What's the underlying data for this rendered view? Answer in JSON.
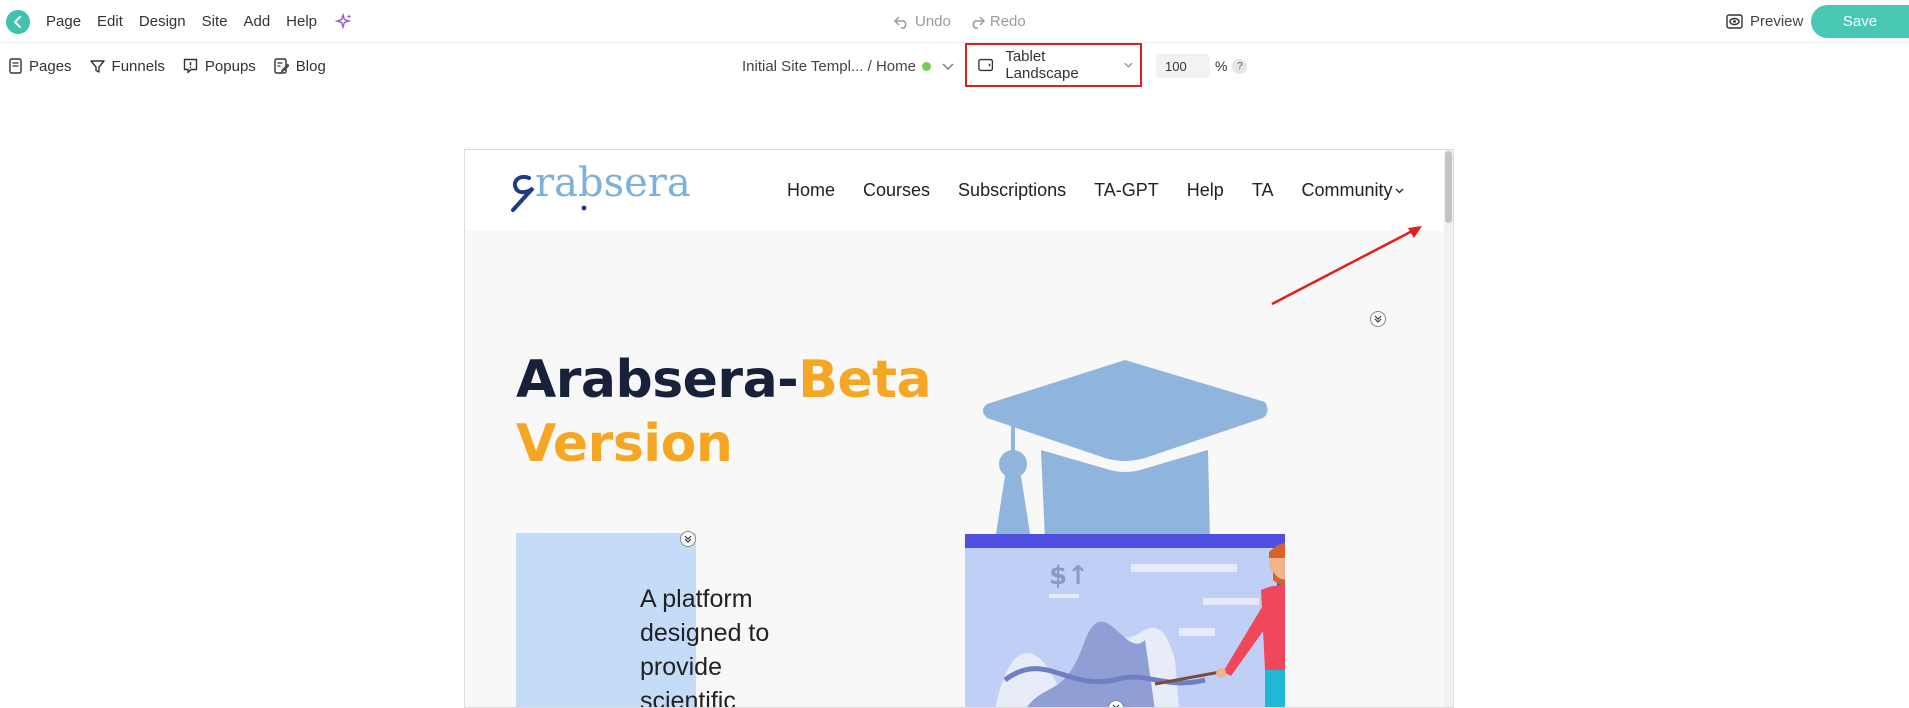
{
  "menu": {
    "items": [
      "Page",
      "Edit",
      "Design",
      "Site",
      "Add",
      "Help"
    ]
  },
  "history": {
    "undo": "Undo",
    "redo": "Redo"
  },
  "actions": {
    "preview": "Preview",
    "save": "Save"
  },
  "tools": [
    "Pages",
    "Funnels",
    "Popups",
    "Blog"
  ],
  "site": {
    "breadcrumb": "Initial Site Templ... / Home"
  },
  "device": {
    "selected": "Tablet Landscape"
  },
  "zoom": {
    "value": "100",
    "unit": "%",
    "help": "?"
  },
  "preview_site": {
    "logo_text": "rabsera",
    "nav": [
      "Home",
      "Courses",
      "Subscriptions",
      "TA-GPT",
      "Help",
      "TA",
      "Community"
    ],
    "hero_title_part1": "Arabsera-",
    "hero_title_part2": "Beta",
    "hero_title_part3": "Version",
    "tagline_lines": [
      "A platform",
      "designed to",
      "provide",
      "scientific"
    ]
  },
  "colors": {
    "accent_teal": "#48c7b2",
    "highlight_red": "#e21e1e",
    "hero_orange": "#f5a623",
    "hero_navy": "#17223a",
    "cap_blue": "#8fb5dd",
    "board_purple": "#5050e0"
  }
}
